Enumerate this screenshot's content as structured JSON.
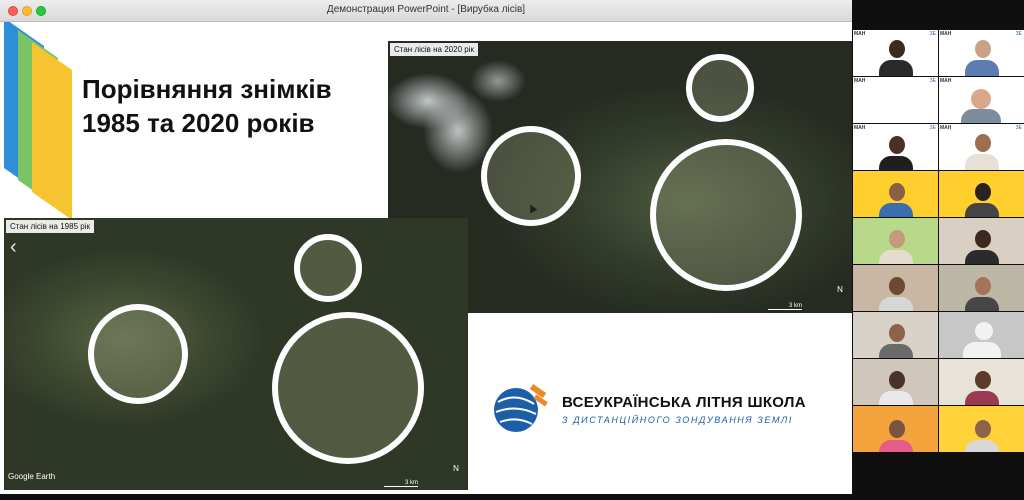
{
  "window": {
    "title": "Демонстрация PowerPoint - [Вирубка лісів]"
  },
  "slide": {
    "title": "Порівняння знімків 1985 та 2020 років",
    "panel_2020": {
      "label": "Стан лісів на 2020 рік",
      "north": "N",
      "scale": "3 km"
    },
    "panel_1985": {
      "label": "Стан лісів на 1985 рік",
      "north": "N",
      "scale": "3 km",
      "attribution": "Google Earth"
    },
    "logo": {
      "line1": "ВСЕУКРАЇНСЬКА ЛІТНЯ ШКОЛА",
      "line2": "З ДИСТАНЦІЙНОГО ЗОНДУВАННЯ ЗЕМЛІ"
    }
  },
  "participants": {
    "label": "МАН",
    "badge": "ЗЕ",
    "count": 18
  },
  "colors": {
    "stripe_blue": "#2e8fd8",
    "stripe_green": "#7cc365",
    "stripe_yellow": "#f6c431",
    "logo_blue": "#1d5ea8",
    "logo_orange": "#e88a2a"
  }
}
